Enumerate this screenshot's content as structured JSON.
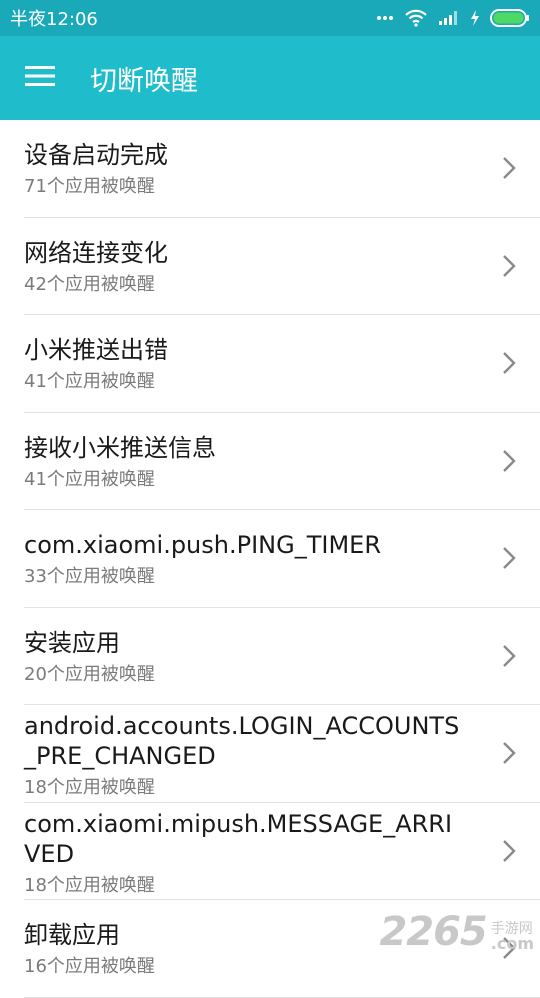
{
  "status_bar": {
    "time": "半夜12:06"
  },
  "app_bar": {
    "title": "切断唤醒"
  },
  "items": [
    {
      "title": "设备启动完成",
      "subtitle": "71个应用被唤醒"
    },
    {
      "title": "网络连接变化",
      "subtitle": "42个应用被唤醒"
    },
    {
      "title": "小米推送出错",
      "subtitle": "41个应用被唤醒"
    },
    {
      "title": "接收小米推送信息",
      "subtitle": "41个应用被唤醒"
    },
    {
      "title": "com.xiaomi.push.PING_TIMER",
      "subtitle": "33个应用被唤醒"
    },
    {
      "title": "安装应用",
      "subtitle": "20个应用被唤醒"
    },
    {
      "title": "android.accounts.LOGIN_ACCOUNTS_PRE_CHANGED",
      "subtitle": "18个应用被唤醒"
    },
    {
      "title": "com.xiaomi.mipush.MESSAGE_ARRIVED",
      "subtitle": "18个应用被唤醒"
    },
    {
      "title": "卸载应用",
      "subtitle": "16个应用被唤醒"
    }
  ],
  "watermark": {
    "number": "2265",
    "cn": "手游网",
    "domain": ".com"
  },
  "colors": {
    "status_bar": "#1aa9b8",
    "app_bar": "#1fbccb",
    "battery": "#4cd964"
  }
}
